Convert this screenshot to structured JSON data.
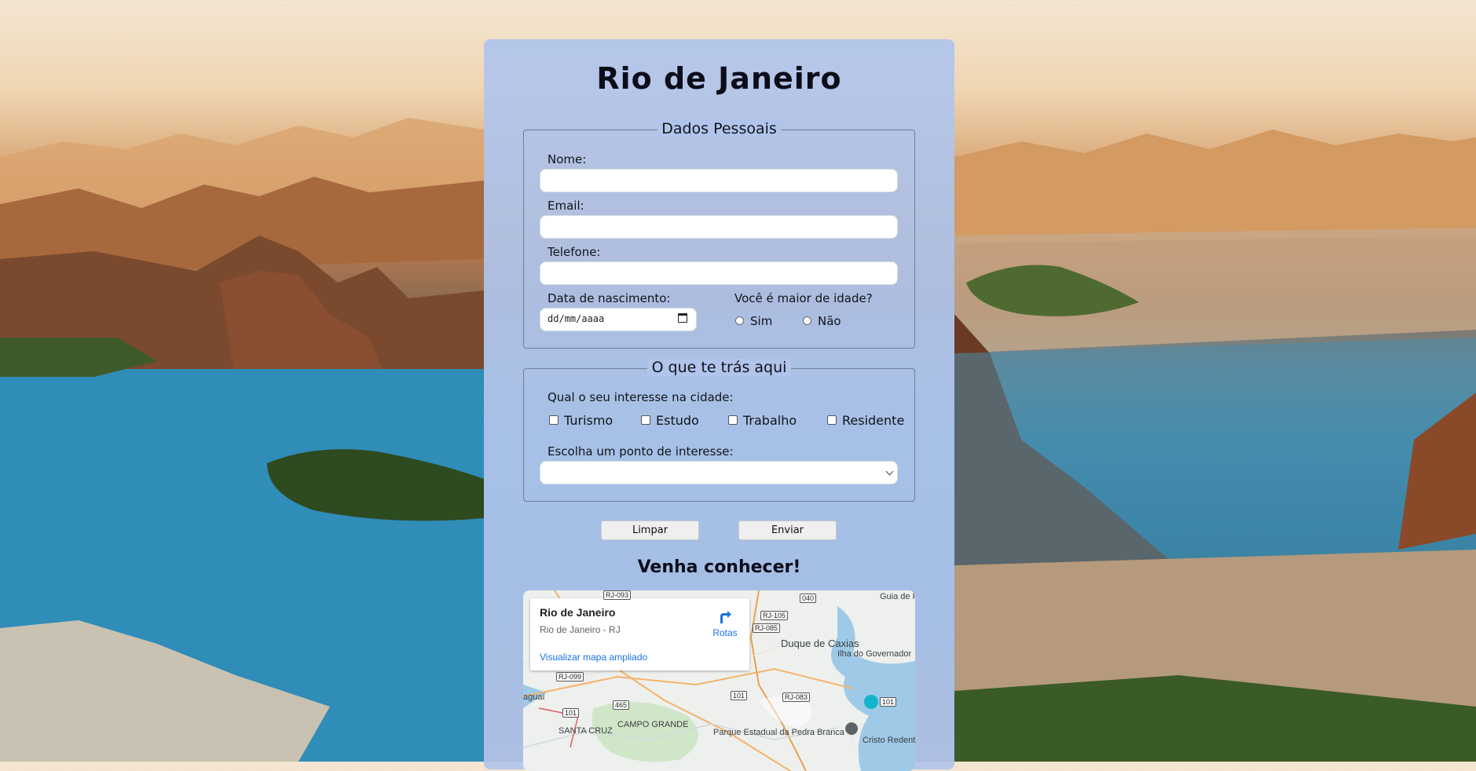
{
  "page": {
    "title": "Rio de Janeiro",
    "subtitle": "Venha conhecer!"
  },
  "personal": {
    "legend": "Dados Pessoais",
    "name_label": "Nome:",
    "email_label": "Email:",
    "phone_label": "Telefone:",
    "birth_label": "Data de nascimento:",
    "birth_value": "dd/mm/aaaa",
    "adult_question": "Você é maior de idade?",
    "adult_yes": "Sim",
    "adult_no": "Não"
  },
  "interest": {
    "legend": "O que te trás aqui",
    "question": "Qual o seu interesse na cidade:",
    "options": [
      "Turismo",
      "Estudo",
      "Trabalho",
      "Residente"
    ],
    "poi_label": "Escolha um ponto de interesse:",
    "poi_selected": ""
  },
  "actions": {
    "clear": "Limpar",
    "send": "Enviar"
  },
  "map": {
    "place_title": "Rio de Janeiro",
    "place_sub": "Rio de Janeiro - RJ",
    "directions": "Rotas",
    "view_larger": "Visualizar mapa ampliado",
    "labels": [
      "Guia de Pacobaíba",
      "Duque de Caxias",
      "Ilha do Governador",
      "CAMPO GRANDE",
      "SANTA CRUZ",
      "Parque Estadual da Pedra Branca",
      "Cristo Redentor",
      "aguaí"
    ],
    "shields": [
      "RJ-093",
      "RJ-105",
      "RJ-085",
      "040",
      "RJ-099",
      "101",
      "465",
      "RJ-083",
      "101",
      "101"
    ]
  }
}
